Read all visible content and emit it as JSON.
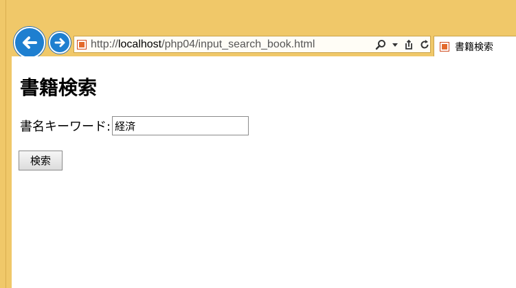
{
  "browser": {
    "url_prefix": "http://",
    "url_host": "localhost",
    "url_path": "/php04/input_search_book.html",
    "tab_title": "書籍検索"
  },
  "icons": {
    "back": "arrow-left-icon",
    "forward": "arrow-right-icon",
    "favicon": "page-favicon-icon",
    "search": "search-icon",
    "dropdown": "chevron-down-icon",
    "compat": "compatibility-view-icon",
    "refresh": "refresh-icon"
  },
  "colors": {
    "frame": "#f0c869",
    "nav_button": "#1e7fd0",
    "content_bg": "#ffffff"
  },
  "page": {
    "heading": "書籍検索",
    "form": {
      "label": "書名キーワード:",
      "keyword_value": "経済",
      "submit_label": "検索"
    }
  }
}
